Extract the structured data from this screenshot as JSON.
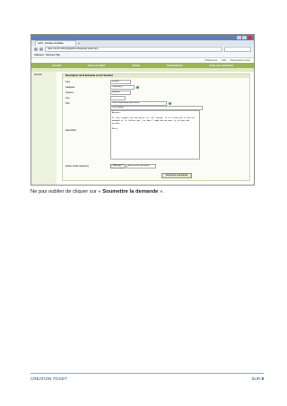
{
  "browser": {
    "title_text": "",
    "tab_label": "GLPI - Interface simplifiée",
    "new_tab": "+",
    "url": "https://10.20.116.184/glpi/front/helpdesk.public.php",
    "user_label": "Utilisateur : Monsieur Pitie"
  },
  "glpi": {
    "top_links": [
      "Préférences",
      "Aide",
      "Déconnexion (user)"
    ],
    "nav": [
      "Accueil",
      "Créer un ticket",
      "Tickets",
      "Réservations",
      "Foire aux questions"
    ],
    "sidebar_label": "Accueil",
    "form": {
      "heading": "Description de la demande ou de l'incident",
      "rows": [
        {
          "label": "Type",
          "value": "Incident",
          "has_tick": false
        },
        {
          "label": "Catégorie",
          "value": "Télécharg. >",
          "has_tick": true
        },
        {
          "label": "Urgence",
          "value": "Moyenne",
          "has_tick": false
        },
        {
          "label": "Lieu",
          "value": "Le ticket porte sur",
          "has_tick": false
        },
        {
          "label": "Titre",
          "value": "Poste téléphonique (personnel)",
          "has_tick": true
        },
        {
          "label": "",
          "value": "Poste bloqué",
          "has_tick": false
        }
      ],
      "description_label": "Description",
      "description_lines": [
        "Bonjour,",
        "Je vous signale que mon poste est très chargé. Je ne trouve pas le dossier demandé et le fichier que j'ai dans l'application mais je ne peux pas accéder",
        "Merci"
      ],
      "file_label": "Fichier (2 Mo maximum)",
      "browse_label": "Parcourir...",
      "file_value": "Aucun fichier sélectionné",
      "submit_label": "Soumettre la demande"
    }
  },
  "instruction": {
    "prefix": "Ne pas oublier de cliquer sur « ",
    "bold": "Soumettre la demande",
    "suffix": " »."
  },
  "footer": {
    "left": "CREATION TICKET",
    "right_prefix": "SUR ",
    "right_num": "8"
  }
}
